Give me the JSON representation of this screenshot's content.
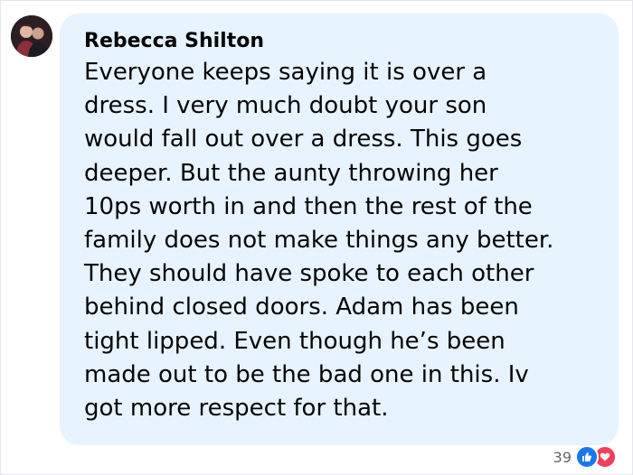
{
  "comment": {
    "author": "Rebecca Shilton",
    "text": "Everyone keeps saying it is over a\ndress. I very much doubt your son\nwould fall out over a dress. This goes\ndeeper. But the aunty throwing her\n10ps worth in and then the rest of the\nfamily does not make things any better.\nThey should have spoke to each other\nbehind closed doors. Adam has been\ntight lipped. Even though he’s been\nmade out to be the bad one in this. Iv\ngot more respect for that."
  },
  "reactions": {
    "count": "39",
    "icons": [
      "like-icon",
      "love-icon"
    ],
    "like_color": "#1877f2",
    "love_color": "#f33e58"
  },
  "colors": {
    "bubble": "#e7f3ff",
    "text": "#050505",
    "meta": "#65676b"
  }
}
